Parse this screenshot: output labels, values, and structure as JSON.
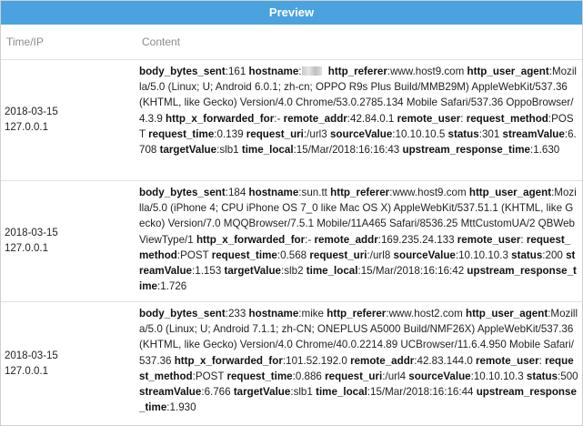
{
  "title": "Preview",
  "columns": {
    "time": "Time/IP",
    "content": "Content"
  },
  "colors": {
    "header_bg": "#4aa3df",
    "border": "#e3e3e3"
  },
  "rows": [
    {
      "date": "2018-03-15",
      "ip": "127.0.0.1",
      "fields": [
        {
          "k": "body_bytes_sent",
          "v": "161"
        },
        {
          "k": "hostname",
          "v": "",
          "redacted": true
        },
        {
          "k": "http_referer",
          "v": "www.host9.com"
        },
        {
          "k": "http_user_agent",
          "v": "Mozilla/5.0 (Linux; U; Android 6.0.1; zh-cn; OPPO R9s Plus Build/MMB29M) AppleWebKit/537.36 (KHTML, like Gecko) Version/4.0 Chrome/53.0.2785.134 Mobile Safari/537.36 OppoBrowser/4.3.9"
        },
        {
          "k": "http_x_forwarded_for",
          "v": "-"
        },
        {
          "k": "remote_addr",
          "v": "42.84.0.1"
        },
        {
          "k": "remote_user",
          "v": ""
        },
        {
          "k": "request_method",
          "v": "POST"
        },
        {
          "k": "request_time",
          "v": "0.139"
        },
        {
          "k": "request_uri",
          "v": "/url3"
        },
        {
          "k": "sourceValue",
          "v": "10.10.10.5"
        },
        {
          "k": "status",
          "v": "301"
        },
        {
          "k": "streamValue",
          "v": "6.708"
        },
        {
          "k": "targetValue",
          "v": "slb1"
        },
        {
          "k": "time_local",
          "v": "15/Mar/2018:16:16:43"
        },
        {
          "k": "upstream_response_time",
          "v": "1.630"
        }
      ]
    },
    {
      "date": "2018-03-15",
      "ip": "127.0.0.1",
      "fields": [
        {
          "k": "body_bytes_sent",
          "v": "184"
        },
        {
          "k": "hostname",
          "v": "sun.tt"
        },
        {
          "k": "http_referer",
          "v": "www.host9.com"
        },
        {
          "k": "http_user_agent",
          "v": "Mozilla/5.0 (iPhone 4; CPU iPhone OS 7_0 like Mac OS X) AppleWebKit/537.51.1 (KHTML, like Gecko) Version/7.0 MQQBrowser/7.5.1 Mobile/11A465 Safari/8536.25 MttCustomUA/2 QBWebViewType/1"
        },
        {
          "k": "http_x_forwarded_for",
          "v": "-"
        },
        {
          "k": "remote_addr",
          "v": "169.235.24.133"
        },
        {
          "k": "remote_user",
          "v": ""
        },
        {
          "k": "request_method",
          "v": "POST"
        },
        {
          "k": "request_time",
          "v": "0.568"
        },
        {
          "k": "request_uri",
          "v": "/url8"
        },
        {
          "k": "sourceValue",
          "v": "10.10.10.3"
        },
        {
          "k": "status",
          "v": "200"
        },
        {
          "k": "streamValue",
          "v": "1.153"
        },
        {
          "k": "targetValue",
          "v": "slb2"
        },
        {
          "k": "time_local",
          "v": "15/Mar/2018:16:16:42"
        },
        {
          "k": "upstream_response_time",
          "v": "1.726"
        }
      ]
    },
    {
      "date": "2018-03-15",
      "ip": "127.0.0.1",
      "fields": [
        {
          "k": "body_bytes_sent",
          "v": "233"
        },
        {
          "k": "hostname",
          "v": "mike"
        },
        {
          "k": "http_referer",
          "v": "www.host2.com"
        },
        {
          "k": "http_user_agent",
          "v": "Mozilla/5.0 (Linux; U; Android 7.1.1; zh-CN; ONEPLUS A5000 Build/NMF26X) AppleWebKit/537.36 (KHTML, like Gecko) Version/4.0 Chrome/40.0.2214.89 UCBrowser/11.6.4.950 Mobile Safari/537.36"
        },
        {
          "k": "http_x_forwarded_for",
          "v": "101.52.192.0"
        },
        {
          "k": "remote_addr",
          "v": "42.83.144.0"
        },
        {
          "k": "remote_user",
          "v": ""
        },
        {
          "k": "request_method",
          "v": "POST"
        },
        {
          "k": "request_time",
          "v": "0.886"
        },
        {
          "k": "request_uri",
          "v": "/url4"
        },
        {
          "k": "sourceValue",
          "v": "10.10.10.3"
        },
        {
          "k": "status",
          "v": "500"
        },
        {
          "k": "streamValue",
          "v": "6.766"
        },
        {
          "k": "targetValue",
          "v": "slb1"
        },
        {
          "k": "time_local",
          "v": "15/Mar/2018:16:16:44"
        },
        {
          "k": "upstream_response_time",
          "v": "1.930"
        }
      ]
    }
  ]
}
